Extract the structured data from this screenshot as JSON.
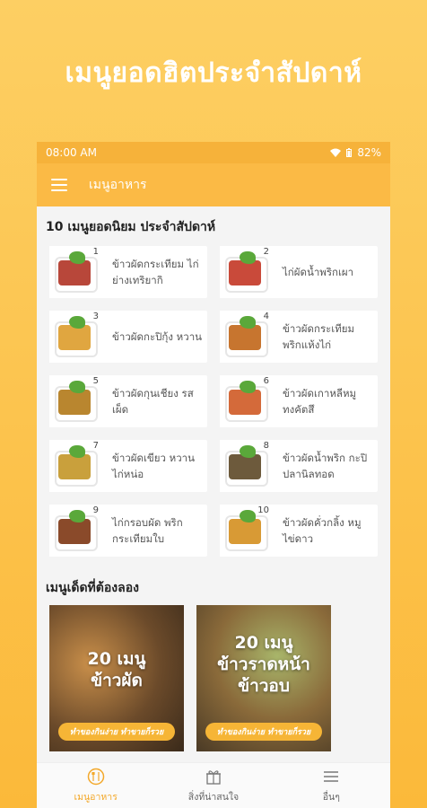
{
  "promo": {
    "title": "เมนูยอดฮิตประจำสัปดาห์"
  },
  "status": {
    "time": "08:00 AM",
    "battery": "82%"
  },
  "appbar": {
    "title": "เมนูอาหาร"
  },
  "top_section": {
    "title": "10 เมนูยอดนิยม ประจำสัปดาห์",
    "items": [
      {
        "rank": "1",
        "label": "ข้าวผัดกระเทียม ไก่ย่างเทริยากิ",
        "food_color": "#b8473a"
      },
      {
        "rank": "2",
        "label": "ไก่ผัดน้ำพริกเผา",
        "food_color": "#c94a3a"
      },
      {
        "rank": "3",
        "label": "ข้าวผัดกะปิกุ้ง หวาน",
        "food_color": "#e0a640"
      },
      {
        "rank": "4",
        "label": "ข้าวผัดกระเทียม พริกแห้งไก่",
        "food_color": "#c7752f"
      },
      {
        "rank": "5",
        "label": "ข้าวผัดกุนเชียง รสเผ็ด",
        "food_color": "#b9862f"
      },
      {
        "rank": "6",
        "label": "ข้าวผัดเกาหลีหมู ทงคัตสึ",
        "food_color": "#d46a3a"
      },
      {
        "rank": "7",
        "label": "ข้าวผัดเขียว หวานไก่หน่อ",
        "food_color": "#c9a03c"
      },
      {
        "rank": "8",
        "label": "ข้าวผัดน้ำพริก กะปิปลานิลทอด",
        "food_color": "#6d5a3c"
      },
      {
        "rank": "9",
        "label": "ไก่กรอบผัด พริกกระเทียมใบ",
        "food_color": "#8a4a2a"
      },
      {
        "rank": "10",
        "label": "ข้าวผัดคั่วกลิ้ง หมูไข่ดาว",
        "food_color": "#d89a35"
      }
    ]
  },
  "second_section": {
    "title": "เมนูเด็ดที่ต้องลอง",
    "banners": [
      {
        "headline_1": "20 เมนู",
        "headline_2": "ข้าวผัด",
        "headline_3": "",
        "pill": "ทำของกินง่าย ทำขายก็รวย",
        "bg_color": "#7a5a3a"
      },
      {
        "headline_1": "20 เมนู",
        "headline_2": "ข้าวราดหน้า",
        "headline_3": "ข้าวอบ",
        "pill": "ทำของกินง่าย ทำขายก็รวย",
        "bg_color": "#8a7a4a"
      }
    ]
  },
  "bottom_nav": [
    {
      "label": "เมนูอาหาร",
      "icon": "food-icon",
      "active": true
    },
    {
      "label": "สิ่งที่น่าสนใจ",
      "icon": "gift-icon",
      "active": false
    },
    {
      "label": "อื่นๆ",
      "icon": "menu-icon",
      "active": false
    }
  ],
  "colors": {
    "accent": "#fbba45",
    "statusbar": "#f6b23a",
    "active_nav": "#f3a82a"
  }
}
